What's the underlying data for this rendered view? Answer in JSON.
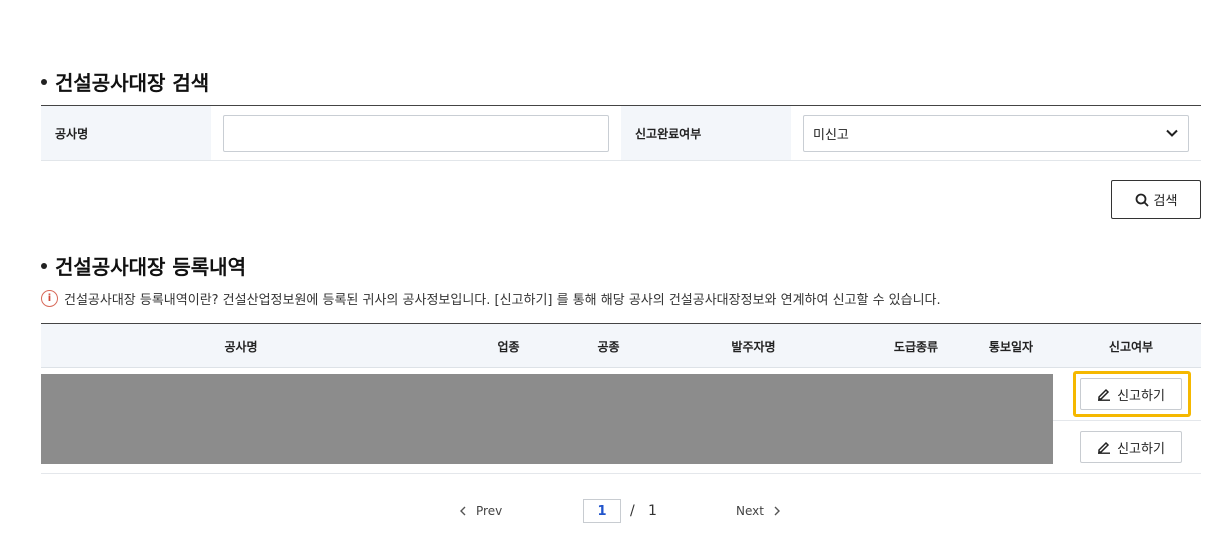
{
  "search_section": {
    "title": "건설공사대장 검색",
    "project_name_label": "공사명",
    "project_name_value": "",
    "report_status_label": "신고완료여부",
    "report_status_selected": "미신고",
    "search_button": "검색"
  },
  "list_section": {
    "title": "건설공사대장 등록내역",
    "info_text": "건설공사대장 등록내역이란? 건설산업정보원에 등록된 귀사의 공사정보입니다. [신고하기] 를 통해 해당 공사의 건설공사대장정보와 연계하여 신고할 수 있습니다.",
    "columns": [
      "공사명",
      "업종",
      "공종",
      "발주자명",
      "도급종류",
      "통보일자",
      "신고여부"
    ],
    "rows": [
      {
        "report_button": "신고하기",
        "highlighted": true
      },
      {
        "report_button": "신고하기",
        "highlighted": false
      }
    ]
  },
  "pagination": {
    "prev_label": "Prev",
    "next_label": "Next",
    "current_page": "1",
    "separator": "/",
    "total_pages": "1"
  },
  "colors": {
    "highlight": "#f5b800",
    "header_bg": "#f3f6fa",
    "redacted": "#8c8c8c",
    "page_active": "#2255cc"
  }
}
